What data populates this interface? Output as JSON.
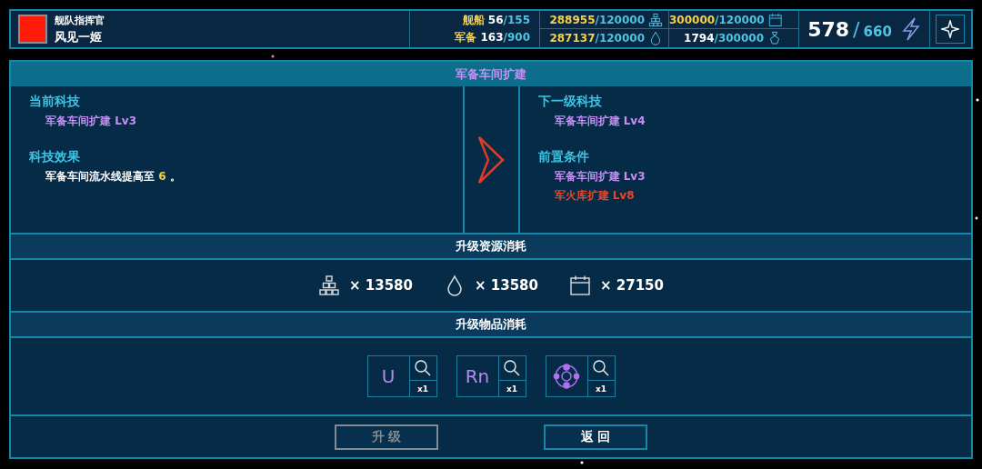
{
  "commander": {
    "title": "舰队指挥官",
    "name": "风见一姬"
  },
  "counts": [
    {
      "label": "舰船",
      "current": "56",
      "separator": "/",
      "max": "155"
    },
    {
      "label": "军备",
      "current": "163",
      "separator": "/",
      "max": "900"
    }
  ],
  "resources": [
    {
      "kind": "blocks",
      "current": "288955",
      "separator": "/",
      "max": "120000",
      "highlight": true
    },
    {
      "kind": "calendar",
      "current": "300000",
      "separator": "/",
      "max": "120000",
      "highlight": true
    },
    {
      "kind": "drop",
      "current": "287137",
      "separator": "/",
      "max": "120000",
      "highlight": true
    },
    {
      "kind": "medal",
      "current": "1794",
      "separator": "/",
      "max": "300000",
      "highlight": false
    }
  ],
  "energy": {
    "current": "578",
    "separator": "/",
    "max": "660"
  },
  "panel": {
    "title": "军备车间扩建",
    "current": [
      {
        "heading": "当前科技",
        "lines": [
          {
            "kind": "tech",
            "text": "军备车间扩建 Lv3"
          }
        ]
      },
      {
        "heading": "科技效果",
        "lines": [
          {
            "kind": "effect",
            "text": "军备车间流水线提高至 ",
            "value": "6",
            "suffix": " 。"
          }
        ]
      }
    ],
    "next": [
      {
        "heading": "下一级科技",
        "lines": [
          {
            "kind": "tech",
            "text": "军备车间扩建 Lv4"
          }
        ]
      },
      {
        "heading": "前置条件",
        "lines": [
          {
            "kind": "requirement",
            "text": "军备车间扩建 Lv3",
            "met": true
          },
          {
            "kind": "requirement",
            "text": "军火库扩建 Lv8",
            "met": false
          }
        ]
      }
    ],
    "cost_title": "升级资源消耗",
    "costs": [
      {
        "kind": "blocks",
        "amount": "× 13580"
      },
      {
        "kind": "drop",
        "amount": "× 13580"
      },
      {
        "kind": "calendar",
        "amount": "× 27150"
      }
    ],
    "items_title": "升级物品消耗",
    "items": [
      {
        "kind": "symbol",
        "symbol": "U",
        "count": "x1"
      },
      {
        "kind": "symbol",
        "symbol": "Rn",
        "count": "x1"
      },
      {
        "kind": "orbit",
        "count": "x1"
      }
    ],
    "buttons": [
      {
        "label": "升 级",
        "disabled": true
      },
      {
        "label": "返 回",
        "disabled": false
      }
    ]
  }
}
